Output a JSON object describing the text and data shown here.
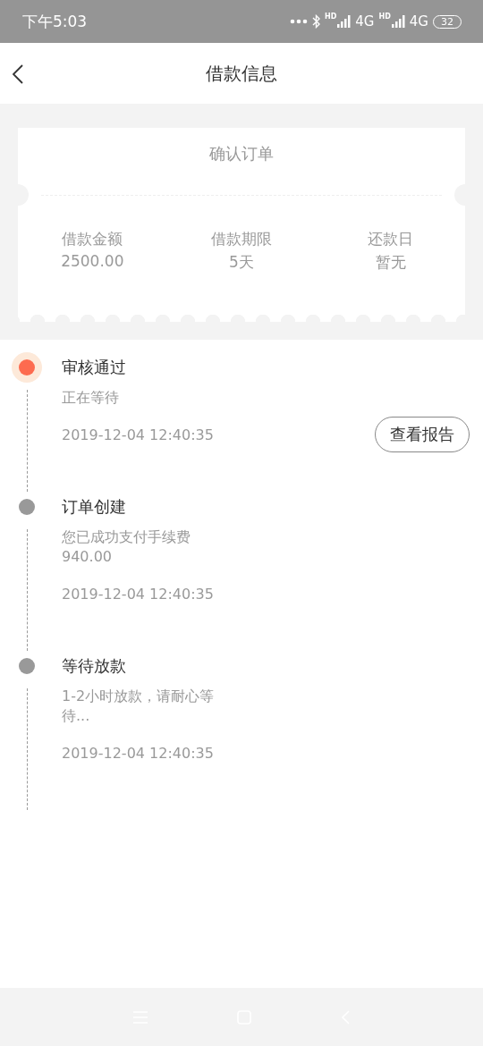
{
  "status_bar": {
    "time": "下午5:03",
    "networks": [
      {
        "badge": "HD",
        "type": "4G"
      },
      {
        "badge": "HD",
        "type": "4G"
      }
    ],
    "battery": "32"
  },
  "header": {
    "title": "借款信息"
  },
  "ticket": {
    "title": "确认订单",
    "fields": [
      {
        "label": "借款金额",
        "value": "2500.00"
      },
      {
        "label": "借款期限",
        "value": "5天"
      },
      {
        "label": "还款日",
        "value": "暂无"
      }
    ]
  },
  "steps": [
    {
      "title": "审核通过",
      "description": "正在等待",
      "time": "2019-12-04 12:40:35",
      "active": true,
      "button": "查看报告"
    },
    {
      "title": "订单创建",
      "description": "您已成功支付手续费940.00",
      "time": "2019-12-04 12:40:35",
      "active": false
    },
    {
      "title": "等待放款",
      "description": "1-2小时放款，请耐心等待...",
      "time": "2019-12-04 12:40:35",
      "active": false
    }
  ]
}
